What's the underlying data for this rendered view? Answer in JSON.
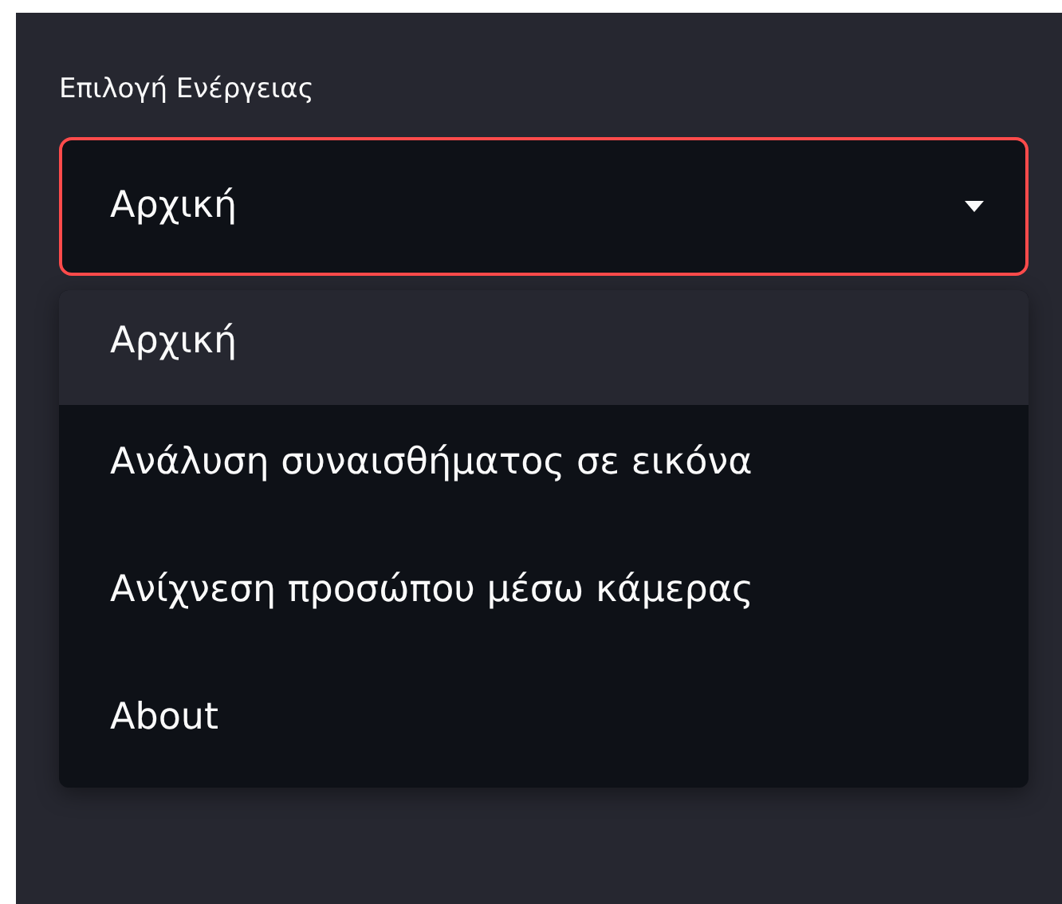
{
  "label": "Επιλογή Ενέργειας",
  "select": {
    "value": "Αρχική",
    "expanded": true
  },
  "options": [
    {
      "label": "Αρχική",
      "selected": true
    },
    {
      "label": "Ανάλυση συναισθήματος σε εικόνα",
      "selected": false
    },
    {
      "label": "Ανίχνεση προσώπου μέσω κάμερας",
      "selected": false
    },
    {
      "label": "About",
      "selected": false
    }
  ]
}
